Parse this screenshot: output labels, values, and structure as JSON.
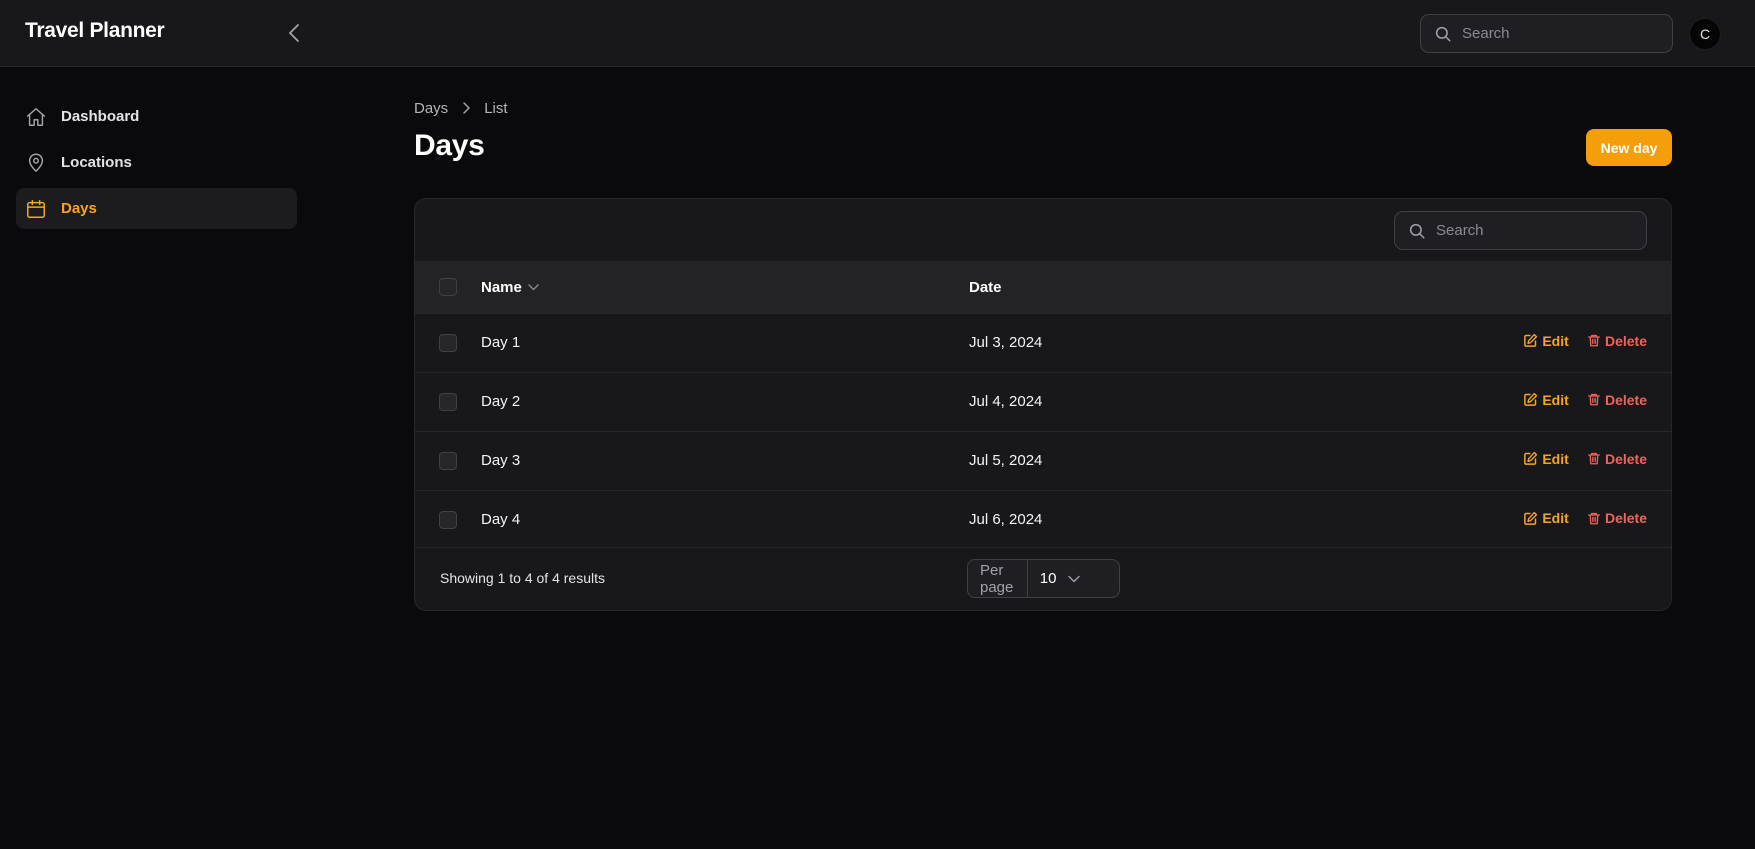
{
  "app": {
    "title": "Travel Planner"
  },
  "header": {
    "search_placeholder": "Search",
    "avatar_initial": "C"
  },
  "sidebar": {
    "items": [
      {
        "label": "Dashboard",
        "icon": "home-icon",
        "active": false
      },
      {
        "label": "Locations",
        "icon": "map-pin-icon",
        "active": false
      },
      {
        "label": "Days",
        "icon": "calendar-icon",
        "active": true
      }
    ]
  },
  "breadcrumb": [
    "Days",
    "List"
  ],
  "page": {
    "title": "Days",
    "new_button": "New day"
  },
  "table": {
    "search_placeholder": "Search",
    "columns": {
      "name": "Name",
      "date": "Date"
    },
    "rows": [
      {
        "name": "Day 1",
        "date": "Jul 3, 2024"
      },
      {
        "name": "Day 2",
        "date": "Jul 4, 2024"
      },
      {
        "name": "Day 3",
        "date": "Jul 5, 2024"
      },
      {
        "name": "Day 4",
        "date": "Jul 6, 2024"
      }
    ],
    "actions": {
      "edit": "Edit",
      "delete": "Delete"
    },
    "footer": {
      "results": "Showing 1 to 4 of 4 results",
      "per_page_label": "Per page",
      "per_page_value": "10"
    }
  },
  "colors": {
    "accent": "#f59e0b",
    "danger": "#f0635b",
    "background": "#0a0a0c",
    "surface": "#18181b"
  }
}
